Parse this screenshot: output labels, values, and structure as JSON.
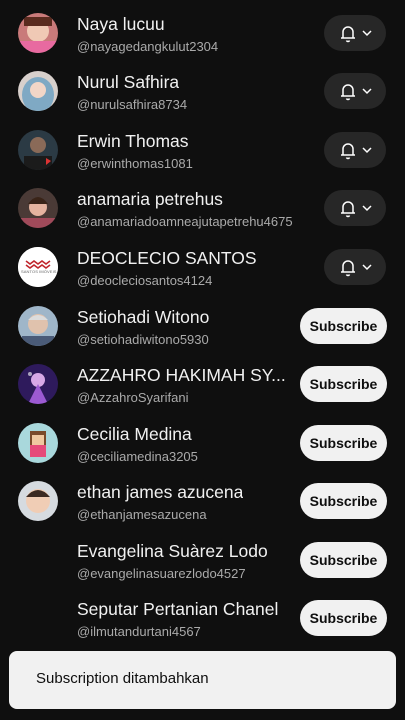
{
  "subscriptions": [
    {
      "name": "Naya lucuu",
      "handle": "@nayagedangkulut2304",
      "state": "subscribed",
      "avatar": "pink-girl"
    },
    {
      "name": "Nurul Safhira",
      "handle": "@nurulsafhira8734",
      "state": "subscribed",
      "avatar": "hijab"
    },
    {
      "name": "Erwin Thomas",
      "handle": "@erwinthomas1081",
      "state": "subscribed",
      "avatar": "dark-man"
    },
    {
      "name": "anamaria petrehus",
      "handle": "@anamariadoamneajutapetrehu4675",
      "state": "subscribed",
      "avatar": "woman-car"
    },
    {
      "name": "DEOCLECIO SANTOS",
      "handle": "@deocleciosantos4124",
      "state": "subscribed",
      "avatar": "logo"
    },
    {
      "name": "Setiohadi Witono",
      "handle": "@setiohadiwitono5930",
      "state": "unsubscribed",
      "avatar": "old-man"
    },
    {
      "name": "AZZAHRO HAKIMAH SY...",
      "handle": "@AzzahroSyarifani",
      "state": "unsubscribed",
      "avatar": "purple-anime"
    },
    {
      "name": "Cecilia Medina",
      "handle": "@ceciliamedina3205",
      "state": "unsubscribed",
      "avatar": "pixel-girl"
    },
    {
      "name": "ethan james azucena",
      "handle": "@ethanjamesazucena",
      "state": "unsubscribed",
      "avatar": "child"
    },
    {
      "name": "Evangelina Suàrez Lodo",
      "handle": "@evangelinasuarezlodo4527",
      "state": "unsubscribed",
      "avatar": "none"
    },
    {
      "name": "Seputar Pertanian Chanel",
      "handle": "@ilmutandurtani4567",
      "state": "unsubscribed",
      "avatar": "none"
    }
  ],
  "subscribe_label": "Subscribe",
  "logo_text": "SANTOS IMÓVEIS",
  "toast": {
    "message": "Subscription ditambahkan"
  },
  "colors": {
    "background": "#0f0f0f",
    "button_dark": "#272727",
    "button_light": "#f1f1f1",
    "secondary_text": "#aaaaaa"
  }
}
